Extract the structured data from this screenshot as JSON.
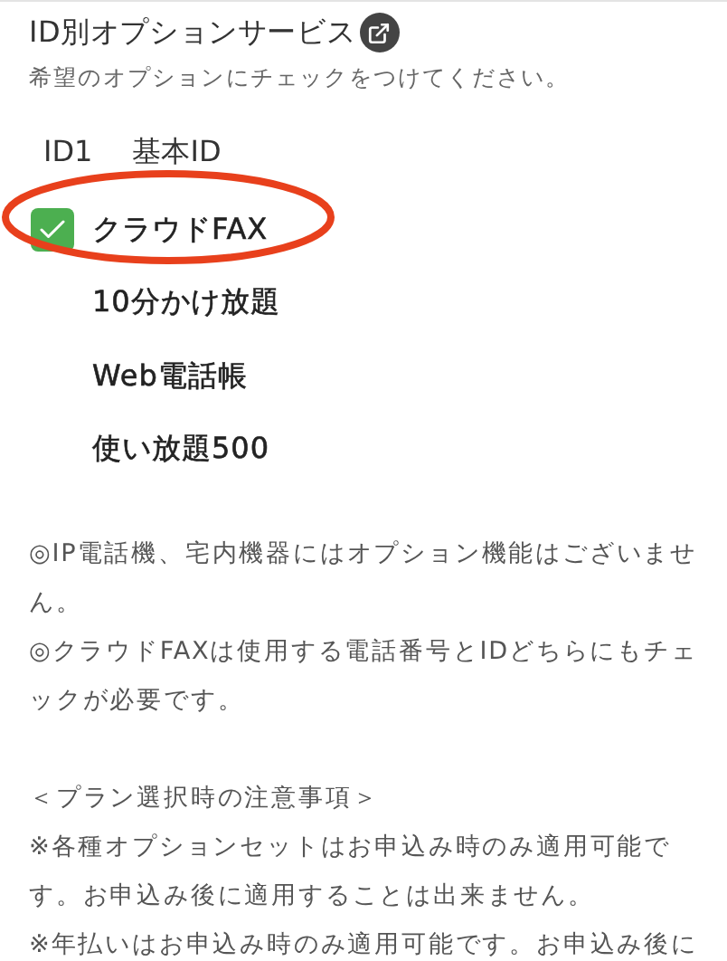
{
  "header": {
    "title": "ID別オプションサービス",
    "subtitle": "希望のオプションにチェックをつけてください。"
  },
  "id_row": {
    "id": "ID1",
    "name": "基本ID"
  },
  "options": [
    {
      "label": "クラウドFAX",
      "checked": true,
      "highlighted": true
    },
    {
      "label": "10分かけ放題",
      "checked": false,
      "highlighted": false
    },
    {
      "label": "Web電話帳",
      "checked": false,
      "highlighted": false
    },
    {
      "label": "使い放題500",
      "checked": false,
      "highlighted": false
    }
  ],
  "notes": [
    {
      "kind": "text",
      "text": "◎IP電話機、宅内機器にはオプション機能はございません。"
    },
    {
      "kind": "text",
      "text": "◎クラウドFAXは使用する電話番号とIDどちらにもチェックが必要です。"
    },
    {
      "kind": "gap"
    },
    {
      "kind": "text",
      "text": "＜プラン選択時の注意事項＞"
    },
    {
      "kind": "text",
      "text": "※各種オプションセットはお申込み時のみ適用可能です。お申込み後に適用することは出来ません。"
    },
    {
      "kind": "text",
      "text": "※年払いはお申込み時のみ適用可能です。お申込み後に"
    }
  ]
}
